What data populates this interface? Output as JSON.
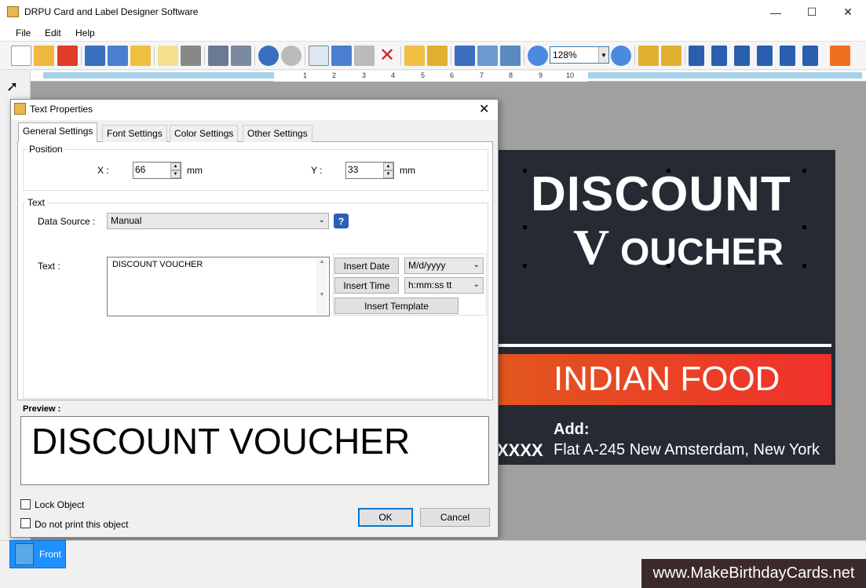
{
  "app": {
    "title": "DRPU Card and Label Designer Software",
    "minimize": "—",
    "maximize": "☐",
    "close": "✕"
  },
  "menu": {
    "file": "File",
    "edit": "Edit",
    "help": "Help"
  },
  "toolbar": {
    "zoom_value": "128%"
  },
  "ruler": {
    "labels": [
      "1",
      "2",
      "3",
      "4",
      "5",
      "6",
      "7",
      "8",
      "9",
      "10"
    ]
  },
  "card": {
    "line1": "DISCOUNT",
    "line2_initial": "V",
    "line2_rest": "OUCHER",
    "band_text": "INDIAN FOOD",
    "add_label": "Add:",
    "phone_partial": "XXXX",
    "address": "Flat A-245 New Amsterdam, New York",
    "background_color": "#262b33",
    "band_color": "#e2561e"
  },
  "dialog": {
    "title": "Text Properties",
    "close": "✕",
    "tabs": [
      "General Settings",
      "Font Settings",
      "Color Settings",
      "Other Settings"
    ],
    "position_group": "Position",
    "x_label": "X :",
    "x_value": "66",
    "x_unit": "mm",
    "y_label": "Y :",
    "y_value": "33",
    "y_unit": "mm",
    "text_group": "Text",
    "data_source_label": "Data Source :",
    "data_source_value": "Manual",
    "help": "?",
    "text_label": "Text :",
    "text_value": "DISCOUNT VOUCHER",
    "insert_date": "Insert Date",
    "date_format": "M/d/yyyy",
    "insert_time": "Insert Time",
    "time_format": "h:mm:ss tt",
    "insert_template": "Insert Template",
    "preview_label": "Preview :",
    "preview_text": "DISCOUNT VOUCHER",
    "lock_object": "Lock Object",
    "do_not_print": "Do not print this object",
    "ok": "OK",
    "cancel": "Cancel"
  },
  "bottom": {
    "front_tab": "Front",
    "watermark": "www.MakeBirthdayCards.net"
  }
}
